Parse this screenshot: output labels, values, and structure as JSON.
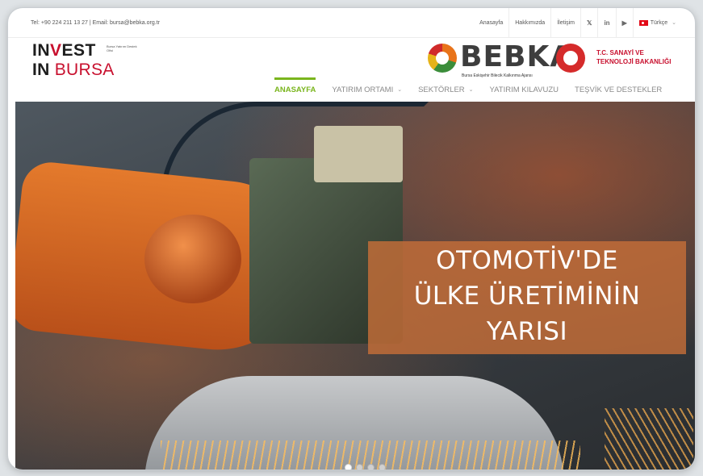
{
  "topbar": {
    "contact": "Tel: +90 224 211 13 27 | Email: bursa@bebka.org.tr",
    "links": [
      "Anasayfa",
      "Hakkımızda",
      "İletişim"
    ],
    "social": [
      {
        "icon": "twitter-icon",
        "glyph": "🐦"
      },
      {
        "icon": "linkedin-icon",
        "glyph": "in"
      },
      {
        "icon": "youtube-icon",
        "glyph": "▶"
      }
    ],
    "language": "Türkçe"
  },
  "brand": {
    "invest_line1_a": "IN",
    "invest_line1_v": "V",
    "invest_line1_b": "EST",
    "invest_line2_a": "IN",
    "invest_line2_b": "BURSA",
    "invest_small": "Bursa Yatırım Destek Ofisi",
    "bebka_word": "BEBKA",
    "bebka_sub": "Bursa Eskişehir Bilecik Kalkınma Ajansı",
    "ministry_line1": "T.C. SANAYİ VE",
    "ministry_line2": "TEKNOLOJİ BAKANLIĞI"
  },
  "nav": {
    "items": [
      {
        "label": "ANASAYFA",
        "active": true,
        "dropdown": false
      },
      {
        "label": "YATIRIM ORTAMI",
        "active": false,
        "dropdown": true
      },
      {
        "label": "SEKTÖRLER",
        "active": false,
        "dropdown": true
      },
      {
        "label": "YATIRIM KILAVUZU",
        "active": false,
        "dropdown": false
      },
      {
        "label": "TEŞVİK VE DESTEKLER",
        "active": false,
        "dropdown": false
      }
    ]
  },
  "hero": {
    "caption_line1": "OTOMOTİV'DE",
    "caption_line2": "ÜLKE ÜRETİMİNİN",
    "caption_line3": "YARISI",
    "slide_count": 4,
    "active_slide": 1
  },
  "colors": {
    "accent_green": "#7ab51d",
    "brand_red": "#c8102e",
    "caption_bg": "#c46e38"
  }
}
